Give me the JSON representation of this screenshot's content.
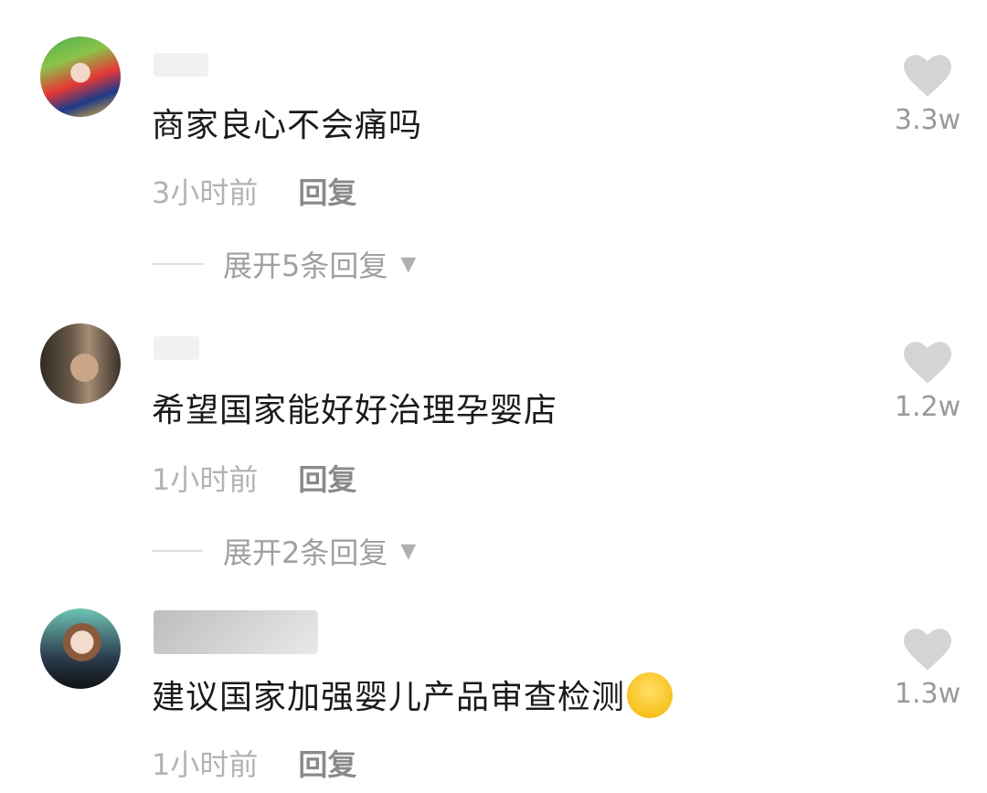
{
  "comments": [
    {
      "text": "商家良心不会痛吗",
      "time": "3小时前",
      "reply_label": "回复",
      "expand_label": "展开5条回复",
      "likes": "3.3w"
    },
    {
      "text": "希望国家能好好治理孕婴店",
      "time": "1小时前",
      "reply_label": "回复",
      "expand_label": "展开2条回复",
      "likes": "1.2w"
    },
    {
      "text": "建议国家加强婴儿产品审查检测",
      "time": "1小时前",
      "reply_label": "回复",
      "likes": "1.3w",
      "emoji": "laughing-crying-emoji"
    }
  ],
  "colors": {
    "heart": "#d4d4d4",
    "time": "#b3b3b3",
    "reply": "#8a8a8a",
    "text": "#1a1a1a"
  }
}
